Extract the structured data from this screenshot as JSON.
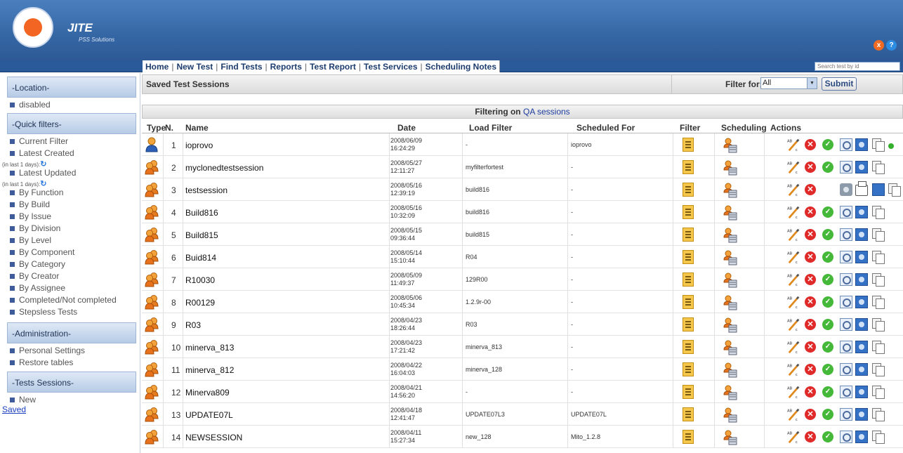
{
  "header": {
    "brand": "JITE",
    "brand_sub": "PSS Solutions",
    "icons": [
      "exit-icon",
      "help-icon"
    ]
  },
  "nav": {
    "items": [
      "Home",
      "New Test",
      "Find Tests",
      "Reports",
      "Test Report",
      "Test Services",
      "Scheduling Notes"
    ],
    "search_placeholder": "Search test by id"
  },
  "sidebar": {
    "location_header": "-Location-",
    "location_item": "disabled",
    "quick_header": "-Quick filters-",
    "quick_items": [
      {
        "label": "Current Filter"
      },
      {
        "label": "Latest Created",
        "note": "(in last 1 days):"
      },
      {
        "label": "Latest Updated",
        "note": "(in last 1 days):"
      },
      {
        "label": "By Function"
      },
      {
        "label": "By Build"
      },
      {
        "label": "By Issue"
      },
      {
        "label": "By Division"
      },
      {
        "label": "By Level"
      },
      {
        "label": "By Component"
      },
      {
        "label": "By Category"
      },
      {
        "label": "By Creator"
      },
      {
        "label": "By Assignee"
      },
      {
        "label": "Completed/Not completed"
      },
      {
        "label": "Stepsless Tests"
      }
    ],
    "admin_header": "-Administration-",
    "admin_items": [
      "Personal Settings",
      "Restore tables"
    ],
    "sessions_header": "-Tests Sessions-",
    "sessions_items": [
      "New"
    ],
    "saved_link": "Saved"
  },
  "main": {
    "title": "Saved Test Sessions",
    "filter_label": "Filter for:",
    "filter_value": "All",
    "submit_label": "Submit",
    "filtering_prefix": "Filtering on",
    "filtering_value": "QA sessions"
  },
  "table": {
    "headers": [
      "Type",
      "N.",
      "Name",
      "Date",
      "Load Filter",
      "Scheduled For",
      "Filter",
      "Scheduling",
      "Actions"
    ],
    "rows": [
      {
        "n": "1",
        "name": "ioprovo",
        "date1": "2008/06/09",
        "date2": "16:24:29",
        "load_filter": "-",
        "scheduled_for": "ioprovo",
        "type": "single"
      },
      {
        "n": "2",
        "name": "myclonedtestsession",
        "date1": "2008/05/27",
        "date2": "12:11:27",
        "load_filter": "myfilterfortest",
        "scheduled_for": "-",
        "type": "group"
      },
      {
        "n": "3",
        "name": "testsession",
        "date1": "2008/05/16",
        "date2": "12:39:19",
        "load_filter": "build816",
        "scheduled_for": "-",
        "type": "group"
      },
      {
        "n": "4",
        "name": "Build816",
        "date1": "2008/05/16",
        "date2": "10:32:09",
        "load_filter": "build816",
        "scheduled_for": "-",
        "type": "group"
      },
      {
        "n": "5",
        "name": "Build815",
        "date1": "2008/05/15",
        "date2": "09:36:44",
        "load_filter": "build815",
        "scheduled_for": "-",
        "type": "group"
      },
      {
        "n": "6",
        "name": "Buid814",
        "date1": "2008/05/14",
        "date2": "15:10:44",
        "load_filter": "R04",
        "scheduled_for": "-",
        "type": "group"
      },
      {
        "n": "7",
        "name": "R10030",
        "date1": "2008/05/09",
        "date2": "11:49:37",
        "load_filter": "129R00",
        "scheduled_for": "-",
        "type": "group"
      },
      {
        "n": "8",
        "name": "R00129",
        "date1": "2008/05/06",
        "date2": "10:45:34",
        "load_filter": "1.2.9r-00",
        "scheduled_for": "-",
        "type": "group"
      },
      {
        "n": "9",
        "name": "R03",
        "date1": "2008/04/23",
        "date2": "18:26:44",
        "load_filter": "R03",
        "scheduled_for": "-",
        "type": "group"
      },
      {
        "n": "10",
        "name": "minerva_813",
        "date1": "2008/04/23",
        "date2": "17:21:42",
        "load_filter": "minerva_813",
        "scheduled_for": "-",
        "type": "group"
      },
      {
        "n": "11",
        "name": "minerva_812",
        "date1": "2008/04/22",
        "date2": "16:04:03",
        "load_filter": "minerva_128",
        "scheduled_for": "-",
        "type": "group"
      },
      {
        "n": "12",
        "name": "Minerva809",
        "date1": "2008/04/21",
        "date2": "14:56:20",
        "load_filter": "-",
        "scheduled_for": "-",
        "type": "group"
      },
      {
        "n": "13",
        "name": "UPDATE07L",
        "date1": "2008/04/18",
        "date2": "12:41:47",
        "load_filter": "UPDATE07L3",
        "scheduled_for": "UPDATE07L",
        "type": "group"
      },
      {
        "n": "14",
        "name": "NEWSESSION",
        "date1": "2008/04/11",
        "date2": "15:27:34",
        "load_filter": "new_128",
        "scheduled_for": "Mito_1.2.8",
        "type": "group"
      }
    ]
  }
}
